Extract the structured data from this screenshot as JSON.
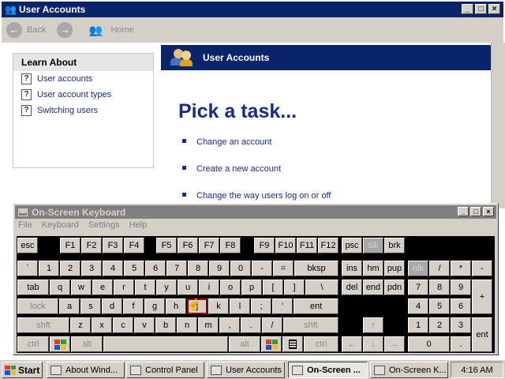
{
  "window": {
    "title": "User Accounts",
    "btn_min": "_",
    "btn_max": "□",
    "btn_close": "×"
  },
  "toolbar": {
    "back": "Back",
    "home": "Home"
  },
  "learn": {
    "heading": "Learn About",
    "items": [
      "User accounts",
      "User account types",
      "Switching users"
    ]
  },
  "main": {
    "banner": "User Accounts",
    "heading": "Pick a task...",
    "tasks": [
      "Change an account",
      "Create a new account",
      "Change the way users log on or off"
    ]
  },
  "osk": {
    "title": "On-Screen Keyboard",
    "menu": [
      "File",
      "Keyboard",
      "Settings",
      "Help"
    ]
  },
  "keys": {
    "esc": "esc",
    "f1": "F1",
    "f2": "F2",
    "f3": "F3",
    "f4": "F4",
    "f5": "F5",
    "f6": "F6",
    "f7": "F7",
    "f8": "F8",
    "f9": "F9",
    "f10": "F10",
    "f11": "F11",
    "f12": "F12",
    "psc": "psc",
    "slk": "slk",
    "brk": "brk",
    "grave": "`",
    "n1": "1",
    "n2": "2",
    "n3": "3",
    "n4": "4",
    "n5": "5",
    "n6": "6",
    "n7": "7",
    "n8": "8",
    "n9": "9",
    "n0": "0",
    "minus": "-",
    "equals": "=",
    "bksp": "bksp",
    "ins": "ins",
    "hm": "hm",
    "pup": "pup",
    "nlk": "nlk",
    "kpdiv": "/",
    "kpmul": "*",
    "kpsub": "-",
    "tab": "tab",
    "q": "q",
    "w": "w",
    "e": "e",
    "r": "r",
    "t": "t",
    "y": "y",
    "u": "u",
    "i": "i",
    "o": "o",
    "p": "p",
    "lbr": "[",
    "rbr": "]",
    "bslash": "\\",
    "del": "del",
    "end": "end",
    "pdn": "pdn",
    "kp7": "7",
    "kp8": "8",
    "kp9": "9",
    "kpadd": "+",
    "lock": "lock",
    "a": "a",
    "s": "s",
    "d": "d",
    "f": "f",
    "g": "g",
    "h": "h",
    "j": "j",
    "k": "k",
    "l": "l",
    "semi": ";",
    "quote": "'",
    "ent": "ent",
    "kp4": "4",
    "kp5": "5",
    "kp6": "6",
    "lshift": "shft",
    "z": "z",
    "x": "x",
    "c": "c",
    "v": "v",
    "b": "b",
    "n": "n",
    "m": "m",
    "comma": ",",
    "period": ".",
    "slash": "/",
    "rshift": "shft",
    "up": "↑",
    "kp1": "1",
    "kp2": "2",
    "kp3": "3",
    "kpent": "ent",
    "lctrl": "ctrl",
    "lalt": "alt",
    "ralt": "alt",
    "rctrl": "ctrl",
    "left": "←",
    "down": "↓",
    "right": "→",
    "kp0": "0",
    "kpdot": "."
  },
  "taskbar": {
    "start": "Start",
    "items": [
      "About Wind...",
      "Control Panel",
      "User Accounts",
      "On-Screen ...",
      "On-Screen K..."
    ],
    "clock": "4:16 AM"
  },
  "colors": {
    "titlebar": "#0a246a",
    "link": "#1a2c8a",
    "face": "#d4d0c8",
    "keyboard_bg": "#000000"
  }
}
